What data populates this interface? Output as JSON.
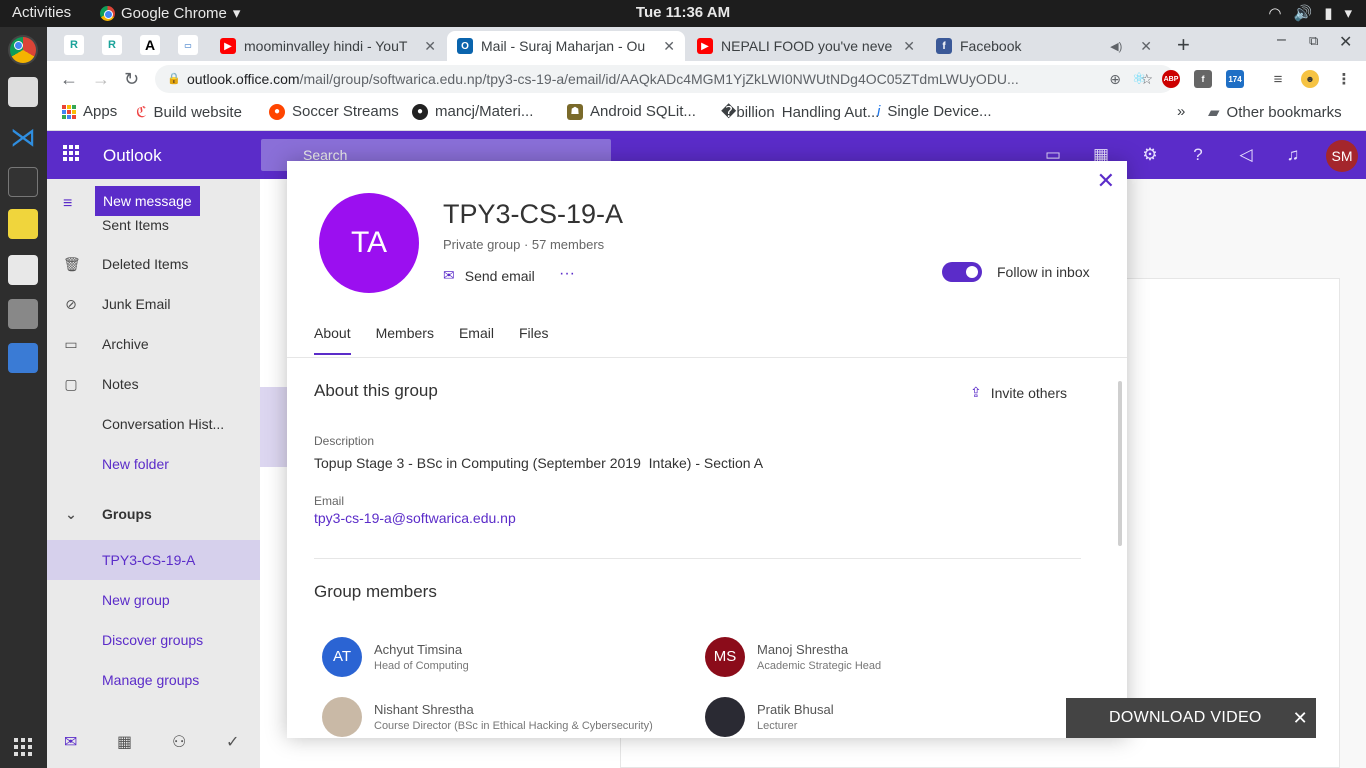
{
  "topbar": {
    "activities": "Activities",
    "app_name": "Google Chrome",
    "clock": "Tue 11:36 AM"
  },
  "tabs": [
    {
      "title": "moominvalley hindi - YouT"
    },
    {
      "title": "Mail - Suraj Maharjan - Ou"
    },
    {
      "title": "NEPALI FOOD you've neve"
    },
    {
      "title": "Facebook"
    }
  ],
  "omnibox": {
    "host": "outlook.office.com",
    "path": "/mail/group/softwarica.edu.np/tpy3-cs-19-a/email/id/AAQkADc4MGM1YjZkLWI0NWUtNDg4OC05ZTdmLWUyODU..."
  },
  "extensions": {
    "badge_count": "174"
  },
  "bookmarks": [
    {
      "label": "Apps"
    },
    {
      "label": "Build website"
    },
    {
      "label": "Soccer Streams"
    },
    {
      "label": "mancj/Materi..."
    },
    {
      "label": "Android SQLit..."
    },
    {
      "label": "Handling Aut..."
    },
    {
      "label": "Single Device..."
    },
    {
      "label": "Other bookmarks"
    }
  ],
  "outlook": {
    "brand": "Outlook",
    "search_placeholder": "Search",
    "avatar_initials": "SM",
    "new_message": "New message",
    "nav": [
      {
        "label": "Sent Items"
      },
      {
        "label": "Deleted Items"
      },
      {
        "label": "Junk Email"
      },
      {
        "label": "Archive"
      },
      {
        "label": "Notes"
      },
      {
        "label": "Conversation Hist..."
      },
      {
        "label": "New folder"
      },
      {
        "label": "Groups"
      },
      {
        "label": "TPY3-CS-19-A"
      },
      {
        "label": "New group"
      },
      {
        "label": "Discover groups"
      },
      {
        "label": "Manage groups"
      }
    ]
  },
  "group_card": {
    "initials": "TA",
    "title": "TPY3-CS-19-A",
    "privacy": "Private group",
    "members_count": "57 members",
    "send_email": "Send email",
    "more": "···",
    "follow_label": "Follow in inbox",
    "follow_on": true,
    "tabs": [
      "About",
      "Members",
      "Email",
      "Files"
    ],
    "about_title": "About this group",
    "invite": "Invite others",
    "description_label": "Description",
    "description": "Topup Stage 3 - BSc in Computing (September 2019  Intake) - Section A",
    "email_label": "Email",
    "email": "tpy3-cs-19-a@softwarica.edu.np",
    "members_title": "Group members",
    "members": [
      {
        "initials": "AT",
        "name": "Achyut Timsina",
        "role": "Head of Computing",
        "color": "#2b64d3"
      },
      {
        "initials": "MS",
        "name": "Manoj Shrestha",
        "role": "Academic Strategic Head",
        "color": "#8b0c1a"
      },
      {
        "initials": "",
        "name": "Nishant Shrestha",
        "role": "Course Director (BSc in Ethical Hacking & Cybersecurity)",
        "color": "#c9b9a6"
      },
      {
        "initials": "",
        "name": "Pratik Bhusal",
        "role": "Lecturer",
        "color": "#2a2a33"
      }
    ]
  },
  "download": {
    "label": "DOWNLOAD VIDEO",
    "close": "✕"
  },
  "colors": {
    "outlook_purple": "#5b2cc9",
    "group_avatar": "#9b0ff0"
  }
}
